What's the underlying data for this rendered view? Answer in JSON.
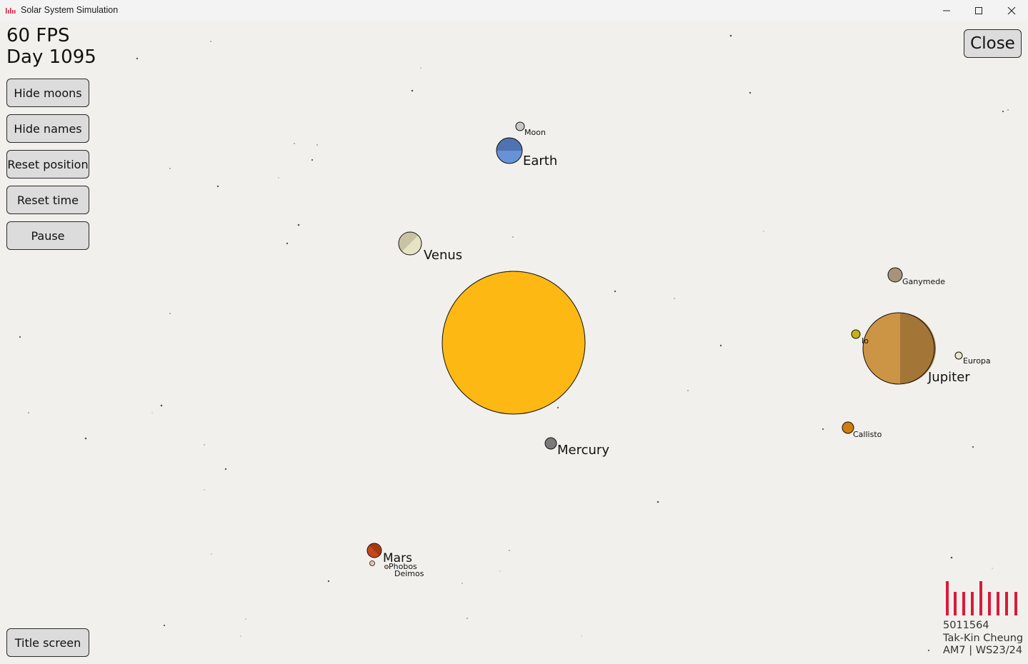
{
  "window": {
    "title": "Solar System Simulation",
    "controls": {
      "minimize_icon": "minimize-icon",
      "maximize_icon": "maximize-icon",
      "close_icon": "close-icon"
    }
  },
  "hud": {
    "fps": "60 FPS",
    "day": "Day 1095"
  },
  "controls": {
    "hide_moons": "Hide moons",
    "hide_names": "Hide names",
    "reset_position": "Reset position",
    "reset_time": "Reset time",
    "pause": "Pause",
    "title_screen": "Title screen",
    "close": "Close"
  },
  "bodies": {
    "sun": {
      "color": "#fdb814"
    },
    "mercury": {
      "name": "Mercury",
      "color": "#7a7a7a"
    },
    "venus": {
      "name": "Venus",
      "color": "#e6e2c4"
    },
    "earth": {
      "name": "Earth",
      "color": "#6891d6"
    },
    "moon": {
      "name": "Moon",
      "color": "#c8c8c8"
    },
    "mars": {
      "name": "Mars",
      "color": "#c7461e"
    },
    "phobos": {
      "name": "Phobos"
    },
    "deimos": {
      "name": "Deimos"
    },
    "jupiter": {
      "name": "Jupiter",
      "color": "#cc9445"
    },
    "io": {
      "name": "Io",
      "color": "#c9b014"
    },
    "europa": {
      "name": "Europa",
      "color": "#ece5cd"
    },
    "ganymede": {
      "name": "Ganymede",
      "color": "#a8937a"
    },
    "callisto": {
      "name": "Callisto",
      "color": "#d07d10"
    }
  },
  "credits": {
    "student_id": "5011564",
    "author": "Tak-Kin Cheung",
    "course": "AM7 | WS23/24",
    "logo_color": "#d91a3a"
  }
}
